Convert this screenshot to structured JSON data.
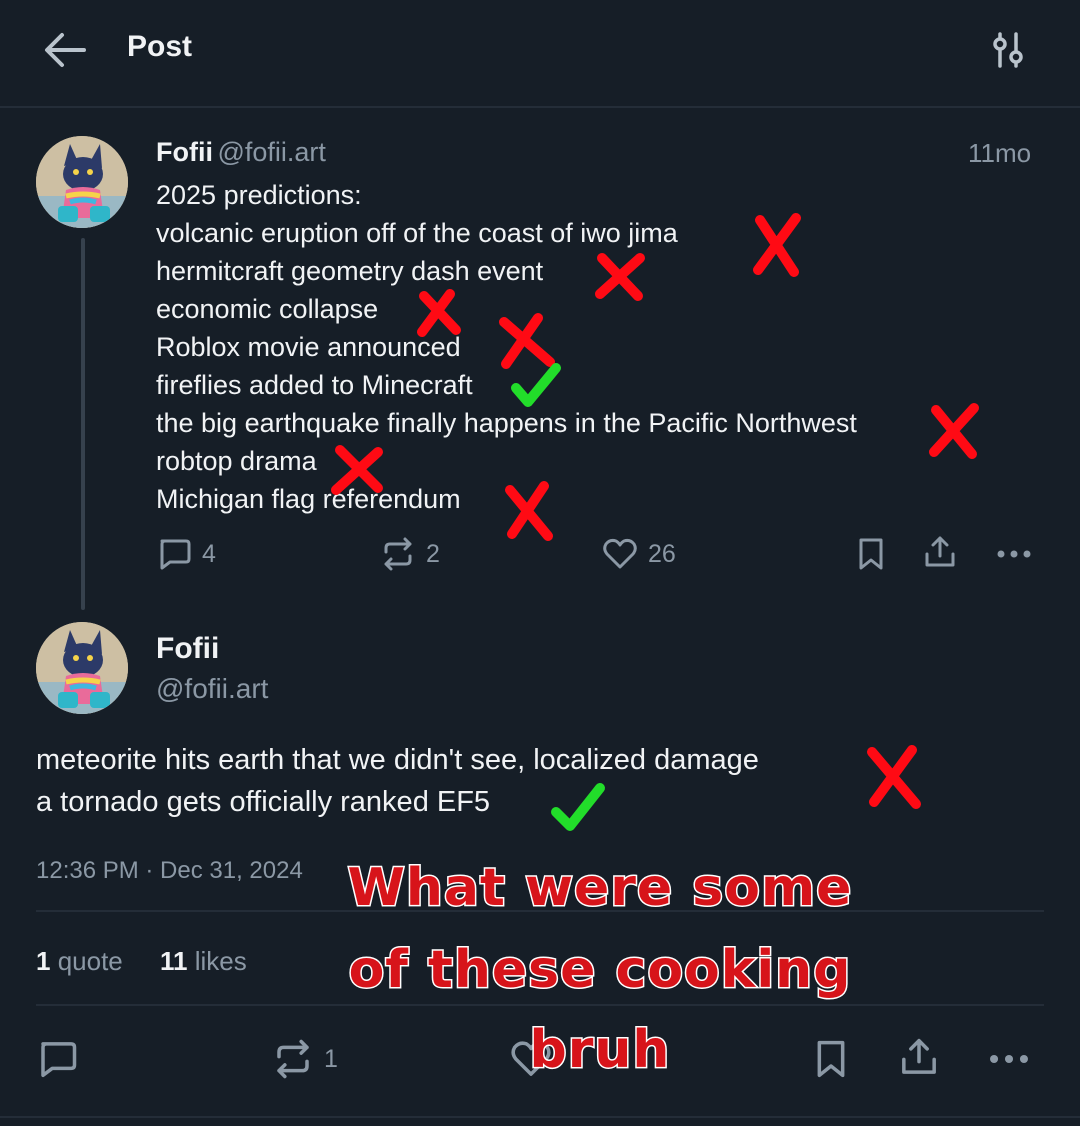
{
  "header": {
    "title": "Post",
    "back_icon": "arrow-left-icon",
    "filter_icon": "sliders-icon"
  },
  "post": {
    "name": "Fofii",
    "handle": "@fofii.art",
    "time_ago": "11mo",
    "lines": [
      "2025 predictions:",
      "volcanic eruption off of the coast of iwo jima",
      "hermitcraft geometry dash event",
      "economic collapse",
      "Roblox movie announced",
      "fireflies added to Minecraft",
      "the big earthquake finally happens in the Pacific Northwest",
      "robtop drama",
      "Michigan flag referendum"
    ],
    "marks": [
      "cross",
      "cross",
      "cross",
      "cross",
      "check",
      "cross",
      "cross",
      "cross"
    ],
    "actions": {
      "replies": "4",
      "reposts": "2",
      "likes": "26"
    }
  },
  "reply": {
    "name": "Fofii",
    "handle": "@fofii.art",
    "lines": [
      "meteorite hits earth that we didn't see, localized damage",
      "a tornado gets officially ranked EF5"
    ],
    "marks": [
      "cross",
      "check"
    ],
    "timestamp": "12:36 PM · Dec 31, 2024",
    "stats": {
      "quotes_count": "1",
      "quotes_label": "quote",
      "likes_count": "11",
      "likes_label": "likes"
    },
    "actions": {
      "reposts": "1"
    }
  },
  "overlay_caption": [
    "What were some",
    "of these cooking",
    "bruh"
  ],
  "colors": {
    "background": "#161e27",
    "muted": "#8b98a5",
    "cross": "#ff0a14",
    "check": "#22dd2a",
    "caption": "#d7141a"
  }
}
